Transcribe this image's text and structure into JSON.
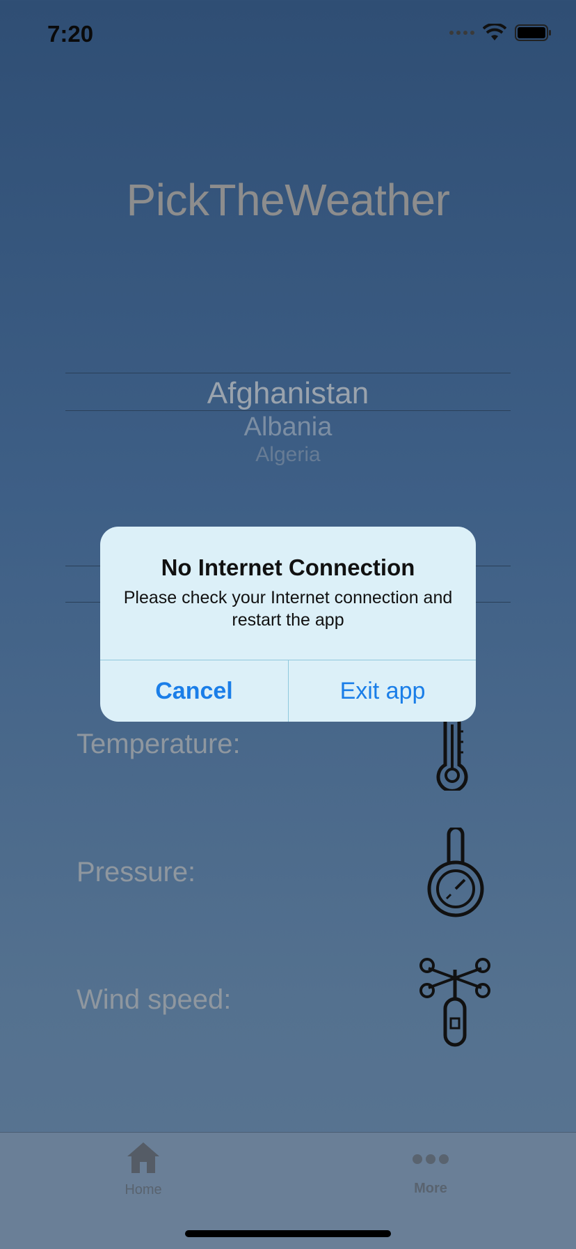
{
  "status_bar": {
    "time": "7:20"
  },
  "app_title": "PickTheWeather",
  "picker": {
    "selected": "Afghanistan",
    "next1": "Albania",
    "next2": "Algeria"
  },
  "rows": [
    {
      "label": "Temperature:",
      "icon": "thermometer-icon"
    },
    {
      "label": "Pressure:",
      "icon": "pressure-gauge-icon"
    },
    {
      "label": "Wind speed:",
      "icon": "anemometer-icon"
    }
  ],
  "alert": {
    "title": "No Internet Connection",
    "message": "Please check your Internet connection and restart the app",
    "cancel_label": "Cancel",
    "exit_label": "Exit app"
  },
  "tabbar": {
    "home_label": "Home",
    "more_label": "More"
  },
  "colors": {
    "accent": "#1a7ee8",
    "alert_bg": "#dcf0f8"
  }
}
